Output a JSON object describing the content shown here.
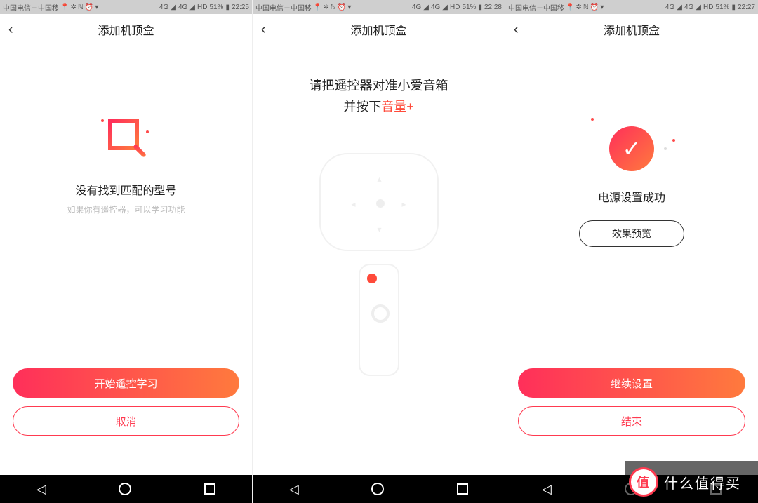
{
  "status": {
    "carrier": "中国电信－中国移",
    "battery": "51%",
    "times": [
      "22:25",
      "22:28",
      "22:27"
    ],
    "signal_label": "4G",
    "hd_label": "HD"
  },
  "title": "添加机顶盒",
  "screen1": {
    "msg_title": "没有找到匹配的型号",
    "msg_sub": "如果你有遥控器，可以学习功能",
    "primary": "开始遥控学习",
    "cancel": "取消"
  },
  "screen2": {
    "line1": "请把遥控器对准小爱音箱",
    "line2_pre": "并按下",
    "line2_accent": "音量+"
  },
  "screen3": {
    "title": "电源设置成功",
    "preview": "效果预览",
    "primary": "继续设置",
    "end": "结束"
  },
  "watermark": {
    "badge": "值",
    "text": "什么值得买"
  }
}
